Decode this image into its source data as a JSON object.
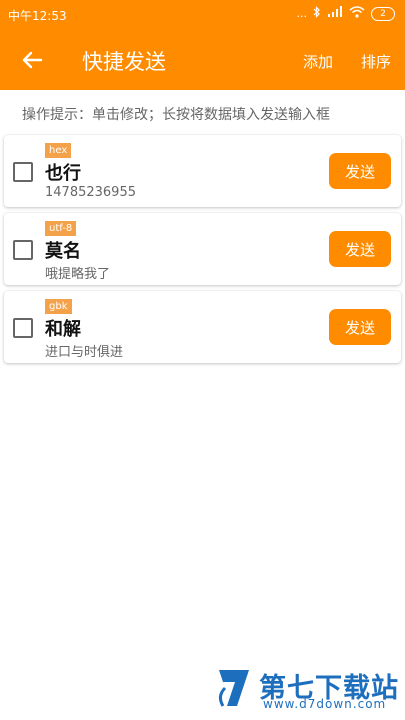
{
  "status_bar": {
    "time": "中午12:53",
    "signal_text": "...",
    "battery": "2"
  },
  "app_bar": {
    "title": "快捷发送",
    "add_label": "添加",
    "sort_label": "排序",
    "background": "#ff8c00"
  },
  "hint": "操作提示：单击修改；长按将数据填入发送输入框",
  "items": [
    {
      "encoding": "hex",
      "name": "也行",
      "data": "14785236955",
      "send_label": "发送",
      "checked": false
    },
    {
      "encoding": "utf-8",
      "name": "莫名",
      "data": "哦提略我了",
      "send_label": "发送",
      "checked": false
    },
    {
      "encoding": "gbk",
      "name": "和解",
      "data": "进口与时俱进",
      "send_label": "发送",
      "checked": false
    }
  ],
  "watermark": {
    "title": "第七下载站",
    "url": "www.d7down.com"
  },
  "colors": {
    "accent": "#ff8c00",
    "badge": "#f4a24a",
    "watermark": "#1d6fbe"
  }
}
